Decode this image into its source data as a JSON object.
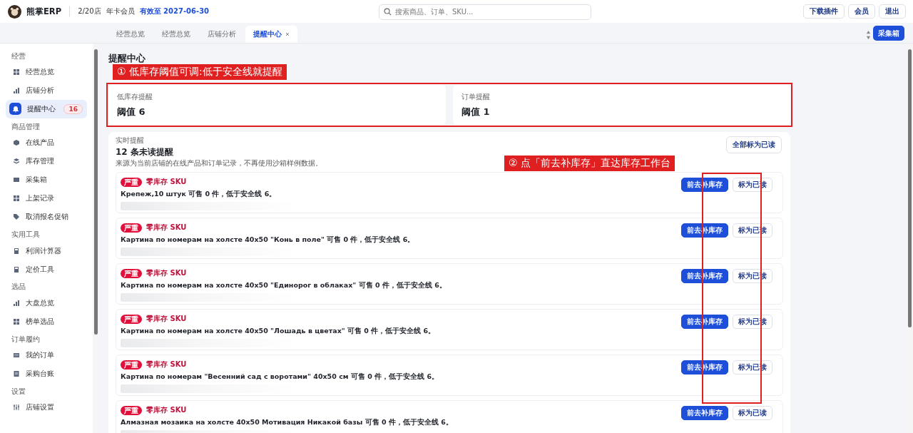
{
  "header": {
    "brand": "熊掌ERP",
    "store_count": "2/20店",
    "plan": "年卡会员",
    "expiry": "有效至 2027-06-30",
    "search": {
      "placeholder": "搜索商品、订单、SKU..."
    },
    "buttons": [
      "下载插件",
      "会员",
      "退出"
    ]
  },
  "tabs": [
    {
      "label": "经营总览",
      "selected": false,
      "closable": false
    },
    {
      "label": "经营总览",
      "selected": false,
      "closable": false
    },
    {
      "label": "店铺分析",
      "selected": false,
      "closable": false
    },
    {
      "label": "提醒中心",
      "selected": true,
      "closable": true
    }
  ],
  "collect_button": "采集箱",
  "sidebar": {
    "groups": [
      {
        "title": "经营",
        "items": [
          {
            "label": "经营总览",
            "selected": false
          },
          {
            "label": "店铺分析",
            "selected": false
          },
          {
            "label": "提醒中心",
            "selected": true,
            "badge": "16"
          }
        ]
      },
      {
        "title": "商品管理",
        "items": [
          {
            "label": "在线产品",
            "selected": false
          },
          {
            "label": "库存管理",
            "selected": false
          },
          {
            "label": "采集箱",
            "selected": false
          },
          {
            "label": "上架记录",
            "selected": false
          },
          {
            "label": "取消报名促销",
            "selected": false
          }
        ]
      },
      {
        "title": "实用工具",
        "items": [
          {
            "label": "利润计算器",
            "selected": false
          },
          {
            "label": "定价工具",
            "selected": false
          }
        ]
      },
      {
        "title": "选品",
        "items": [
          {
            "label": "大盘总览",
            "selected": false
          },
          {
            "label": "榜单选品",
            "selected": false
          }
        ]
      },
      {
        "title": "订单履约",
        "items": [
          {
            "label": "我的订单",
            "selected": false
          },
          {
            "label": "采购台账",
            "selected": false
          }
        ]
      },
      {
        "title": "设置",
        "items": [
          {
            "label": "店铺设置",
            "selected": false
          }
        ]
      }
    ]
  },
  "page": {
    "title": "提醒中心",
    "summary_cards": [
      {
        "label": "低库存提醒",
        "value": "阈值 6"
      },
      {
        "label": "订单提醒",
        "value": "阈值 1"
      }
    ],
    "panel": {
      "eyebrow": "实时提醒",
      "heading": "12 条未读提醒",
      "note": "来源为当前店铺的在线产品和订单记录，不再使用沙箱样例数据。",
      "mark_all_button": "全部标为已读",
      "alerts": [
        {
          "severity": "严重",
          "category": "零库存 SKU",
          "message": "Крепеж,10 штук 可售 0 件，低于安全线 6。",
          "actions": [
            "前去补库存",
            "标为已读"
          ]
        },
        {
          "severity": "严重",
          "category": "零库存 SKU",
          "message": "Картина по номерам на холсте 40х50 \"Конь в поле\" 可售 0 件，低于安全线 6。",
          "actions": [
            "前去补库存",
            "标为已读"
          ]
        },
        {
          "severity": "严重",
          "category": "零库存 SKU",
          "message": "Картина по номерам на холсте 40х50 \"Единорог в облаках\" 可售 0 件，低于安全线 6。",
          "actions": [
            "前去补库存",
            "标为已读"
          ]
        },
        {
          "severity": "严重",
          "category": "零库存 SKU",
          "message": "Картина по номерам на холсте 40х50 \"Лошадь в цветах\" 可售 0 件，低于安全线 6。",
          "actions": [
            "前去补库存",
            "标为已读"
          ]
        },
        {
          "severity": "严重",
          "category": "零库存 SKU",
          "message": "Картина по номерам \"Весенний сад с воротами\" 40х50 см 可售 0 件，低于安全线 6。",
          "actions": [
            "前去补库存",
            "标为已读"
          ]
        },
        {
          "severity": "严重",
          "category": "零库存 SKU",
          "message": "Алмазная мозаика на холсте 40х50 Мотивация Никакой базы 可售 0 件，低于安全线 6。",
          "actions": [
            "前去补库存",
            "标为已读"
          ]
        }
      ]
    }
  },
  "annotations": [
    "① 低库存阈值可调:低于安全线就提醒",
    "② 点「前去补库存」直达库存工作台"
  ]
}
